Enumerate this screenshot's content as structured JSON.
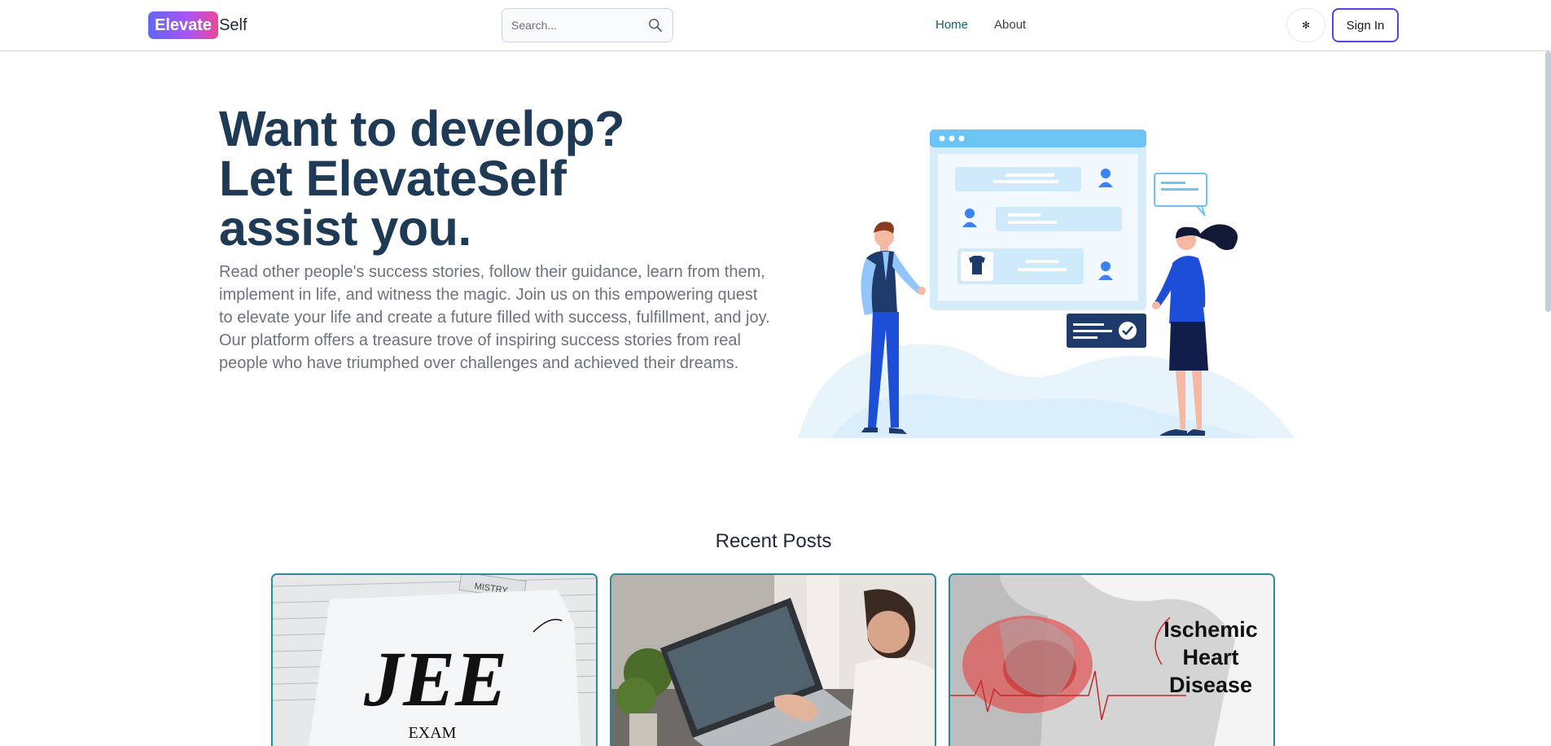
{
  "nav": {
    "logo_badge": "Elevate",
    "logo_rest": "Self",
    "search_placeholder": "Search...",
    "links": [
      {
        "label": "Home",
        "active": true
      },
      {
        "label": "About",
        "active": false
      }
    ],
    "theme_icon": "✻",
    "signin_label": "Sign In"
  },
  "hero": {
    "title_line1": "Want to develop?",
    "title_line2": "Let ElevateSelf",
    "title_line3": "assist you.",
    "paragraph": "Read other people's success stories, follow their guidance, learn from them, implement in life, and witness the magic. Join us on this empowering quest to elevate your life and create a future filled with success, fulfillment, and joy. Our platform offers a treasure trove of inspiring success stories from real people who have triumphed over challenges and achieved their dreams."
  },
  "recent": {
    "title": "Recent Posts",
    "posts": [
      {
        "image_word": "JEE",
        "image_sub": "EXAM",
        "image_stamp": "MISTRY"
      },
      {},
      {
        "image_line1": "Ischemic",
        "image_line2": "Heart",
        "image_line3": "Disease"
      }
    ]
  },
  "colors": {
    "brand_gradient_start": "#6366f1",
    "brand_gradient_end": "#ec4899",
    "hero_title": "#1e3a55",
    "card_border": "#2b8a9a",
    "signin_border": "#4f46e5",
    "active_link": "#155e75"
  }
}
